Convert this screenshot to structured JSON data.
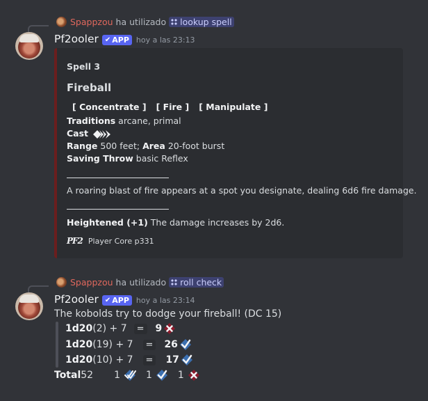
{
  "messages": [
    {
      "reply": {
        "user": "Spappzou",
        "verb": "ha utilizado",
        "command": "lookup spell"
      },
      "bot": "Pf2ooler",
      "badge": "APP",
      "timestamp": "hoy a las 23:13",
      "embed": {
        "level": "Spell 3",
        "name": "Fireball",
        "traits": [
          "[ Concentrate ]",
          "[ Fire ]",
          "[ Manipulate ]"
        ],
        "traditions_label": "Traditions",
        "traditions_value": " arcane, primal",
        "cast_label": "Cast",
        "range_label": "Range",
        "range_value": " 500 feet; ",
        "area_label": "Area",
        "area_value": " 20-foot burst",
        "saving_label": "Saving Throw",
        "saving_value": " basic Reflex",
        "description": "A roaring blast of fire appears at a spot you designate, dealing 6d6 fire damage.",
        "heightened_label": "Heightened (+1)",
        "heightened_value": " The damage increases by 2d6.",
        "footer_logo": "PF2",
        "footer": "Player Core p331",
        "accent_color": "#6b1e1e"
      }
    },
    {
      "reply": {
        "user": "Spappzou",
        "verb": "ha utilizado",
        "command": "roll check"
      },
      "bot": "Pf2ooler",
      "badge": "APP",
      "timestamp": "hoy a las 23:14",
      "text": "The kobolds try to dodge your fireball! (DC 15)",
      "rolls": [
        {
          "dice": "1d20",
          "detail": " (2) + 7",
          "eq": "=",
          "result": "9",
          "outcome": "failure"
        },
        {
          "dice": "1d20",
          "detail": " (19) + 7",
          "eq": "=",
          "result": "26",
          "outcome": "success"
        },
        {
          "dice": "1d20",
          "detail": " (10) + 7",
          "eq": "=",
          "result": "17",
          "outcome": "success"
        }
      ],
      "total_label": "Total",
      "total_value": " 52",
      "tallies": [
        {
          "count": "1",
          "outcome": "critical-success"
        },
        {
          "count": "1",
          "outcome": "success"
        },
        {
          "count": "1",
          "outcome": "failure"
        }
      ]
    }
  ],
  "colors": {
    "background": "#313338",
    "accent": "#5865f2",
    "username": "#e0685d",
    "success": "#4b8fd6",
    "failure": "#b3263a"
  }
}
